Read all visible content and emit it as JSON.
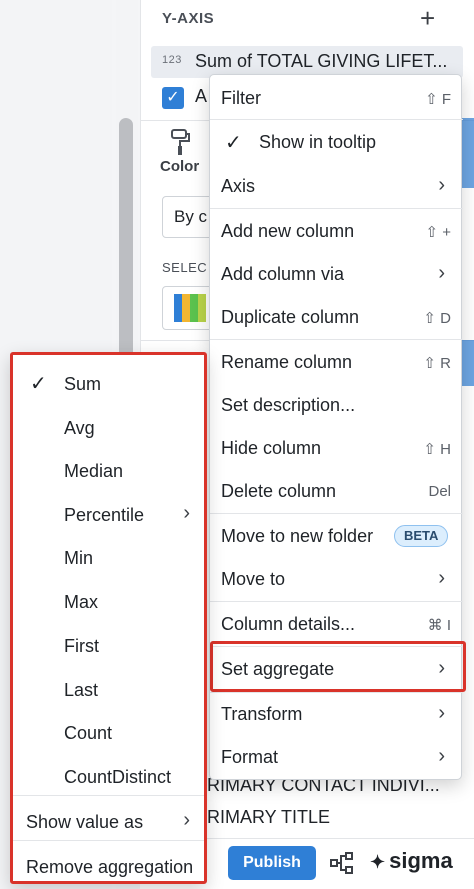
{
  "panel": {
    "y_axis_title": "Y-AXIS",
    "add_icon": "plus-icon",
    "column": {
      "type_label": "123",
      "name": "Sum of TOTAL GIVING LIFET..."
    },
    "checkbox_label": "A",
    "color_label": "Color",
    "color_select_value": "By c",
    "select_label": "SELEC",
    "palette_colors": [
      "#2f7fd6",
      "#f2b632",
      "#5cc24e",
      "#b9d34a"
    ],
    "fields": [
      "RIMARY CONTACT INDIVI...",
      "RIMARY TITLE"
    ]
  },
  "footer": {
    "publish_label": "Publish",
    "logo_text": "sigma"
  },
  "menu": {
    "filter": {
      "label": "Filter",
      "shortcut": "⇧ F"
    },
    "show_in_tooltip": {
      "label": "Show in tooltip",
      "checked": true
    },
    "axis": {
      "label": "Axis"
    },
    "add_new_column": {
      "label": "Add new column",
      "shortcut": "⇧ +"
    },
    "add_column_via": {
      "label": "Add column via"
    },
    "duplicate_column": {
      "label": "Duplicate column",
      "shortcut": "⇧ D"
    },
    "rename_column": {
      "label": "Rename column",
      "shortcut": "⇧ R"
    },
    "set_description": {
      "label": "Set description..."
    },
    "hide_column": {
      "label": "Hide column",
      "shortcut": "⇧ H"
    },
    "delete_column": {
      "label": "Delete column",
      "shortcut": "Del"
    },
    "move_to_new_folder": {
      "label": "Move to new folder",
      "badge": "BETA"
    },
    "move_to": {
      "label": "Move to"
    },
    "column_details": {
      "label": "Column details...",
      "shortcut": "⌘ I"
    },
    "set_aggregate": {
      "label": "Set aggregate"
    },
    "transform": {
      "label": "Transform"
    },
    "format": {
      "label": "Format"
    }
  },
  "aggregate_menu": {
    "items": [
      "Sum",
      "Avg",
      "Median",
      "Percentile",
      "Min",
      "Max",
      "First",
      "Last",
      "Count",
      "CountDistinct"
    ],
    "selected": "Sum",
    "show_value_as": "Show value as",
    "remove_aggregation": "Remove aggregation"
  },
  "colors": {
    "accent": "#2f7fd6",
    "highlight_border": "#d9332a",
    "beta_badge_bg": "#dceefd"
  }
}
